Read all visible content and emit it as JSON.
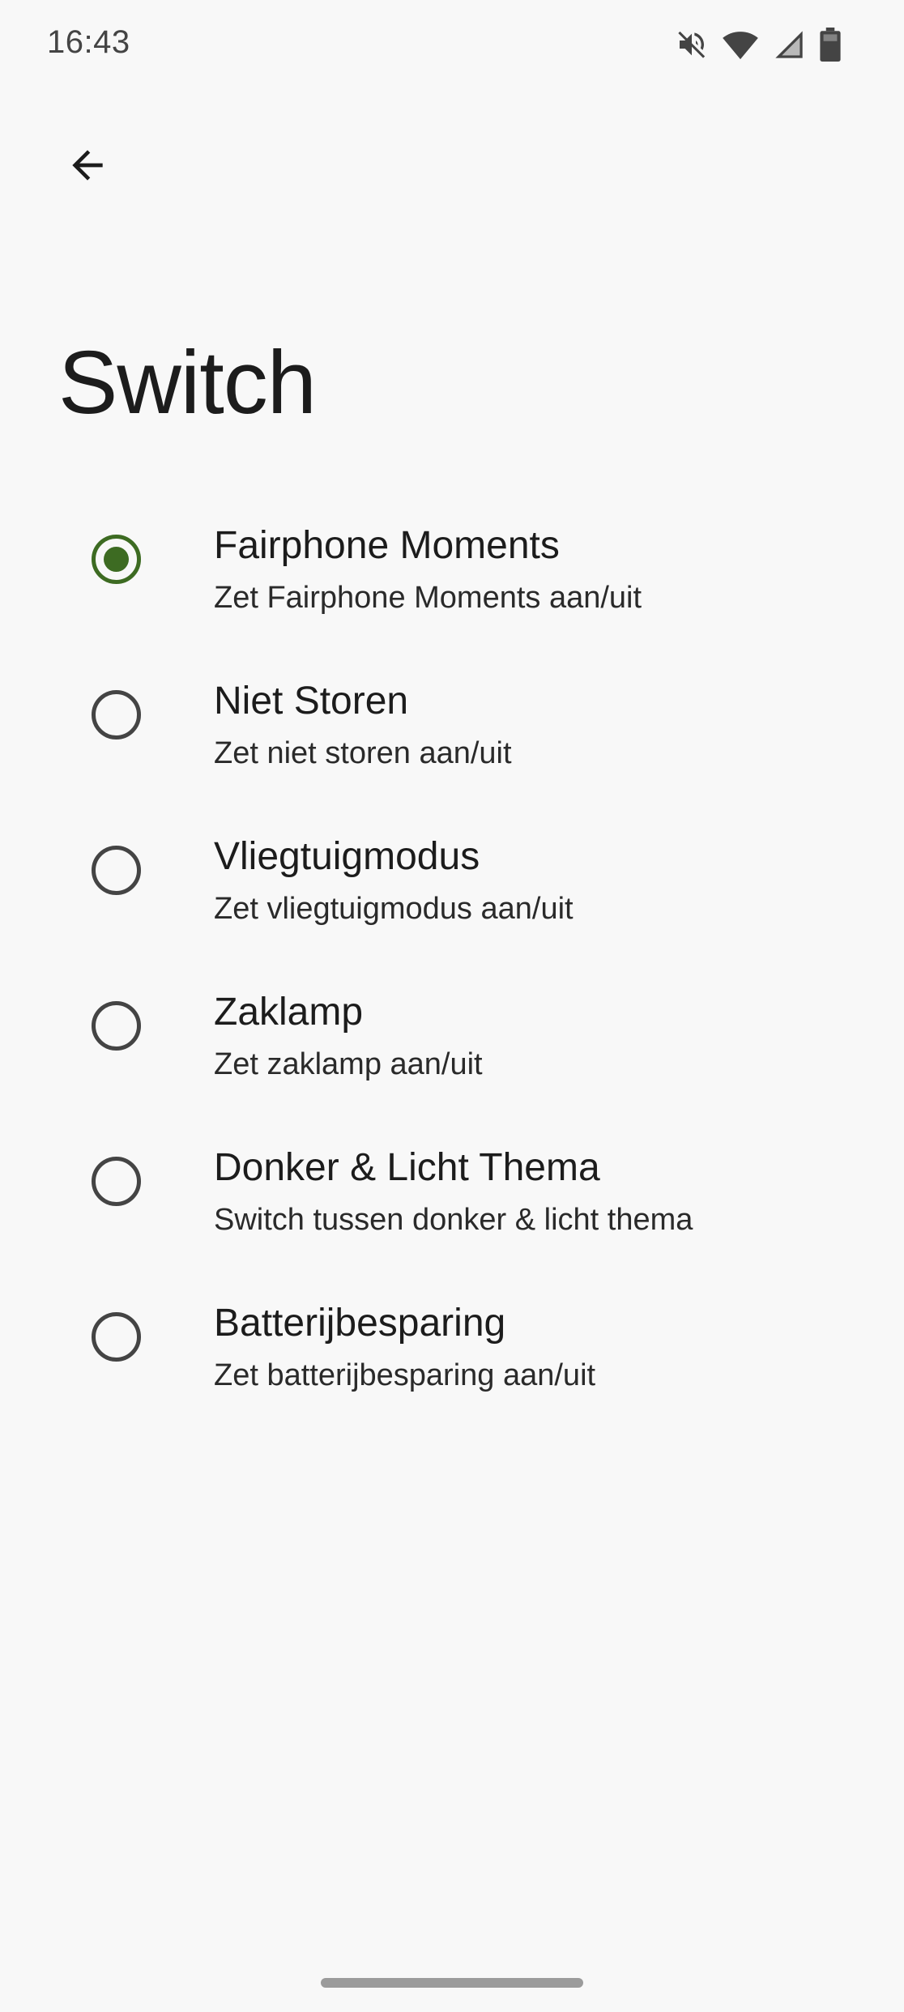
{
  "status_bar": {
    "time": "16:43",
    "icons": [
      "mute-icon",
      "wifi-icon",
      "signal-icon",
      "battery-icon"
    ]
  },
  "nav": {
    "back_icon": "arrow-back-icon"
  },
  "page": {
    "title": "Switch"
  },
  "options": [
    {
      "title": "Fairphone Moments",
      "subtitle": "Zet Fairphone Moments aan/uit",
      "selected": true
    },
    {
      "title": "Niet Storen",
      "subtitle": "Zet niet storen aan/uit",
      "selected": false
    },
    {
      "title": "Vliegtuigmodus",
      "subtitle": "Zet vliegtuigmodus aan/uit",
      "selected": false
    },
    {
      "title": "Zaklamp",
      "subtitle": "Zet zaklamp aan/uit",
      "selected": false
    },
    {
      "title": "Donker & Licht Thema",
      "subtitle": "Switch tussen donker & licht thema",
      "selected": false
    },
    {
      "title": "Batterijbesparing",
      "subtitle": "Zet batterijbesparing aan/uit",
      "selected": false
    }
  ],
  "colors": {
    "background": "#f8f8f8",
    "accent": "#3d6b22",
    "text_primary": "#1c1c1c",
    "radio_unchecked": "#444444"
  }
}
